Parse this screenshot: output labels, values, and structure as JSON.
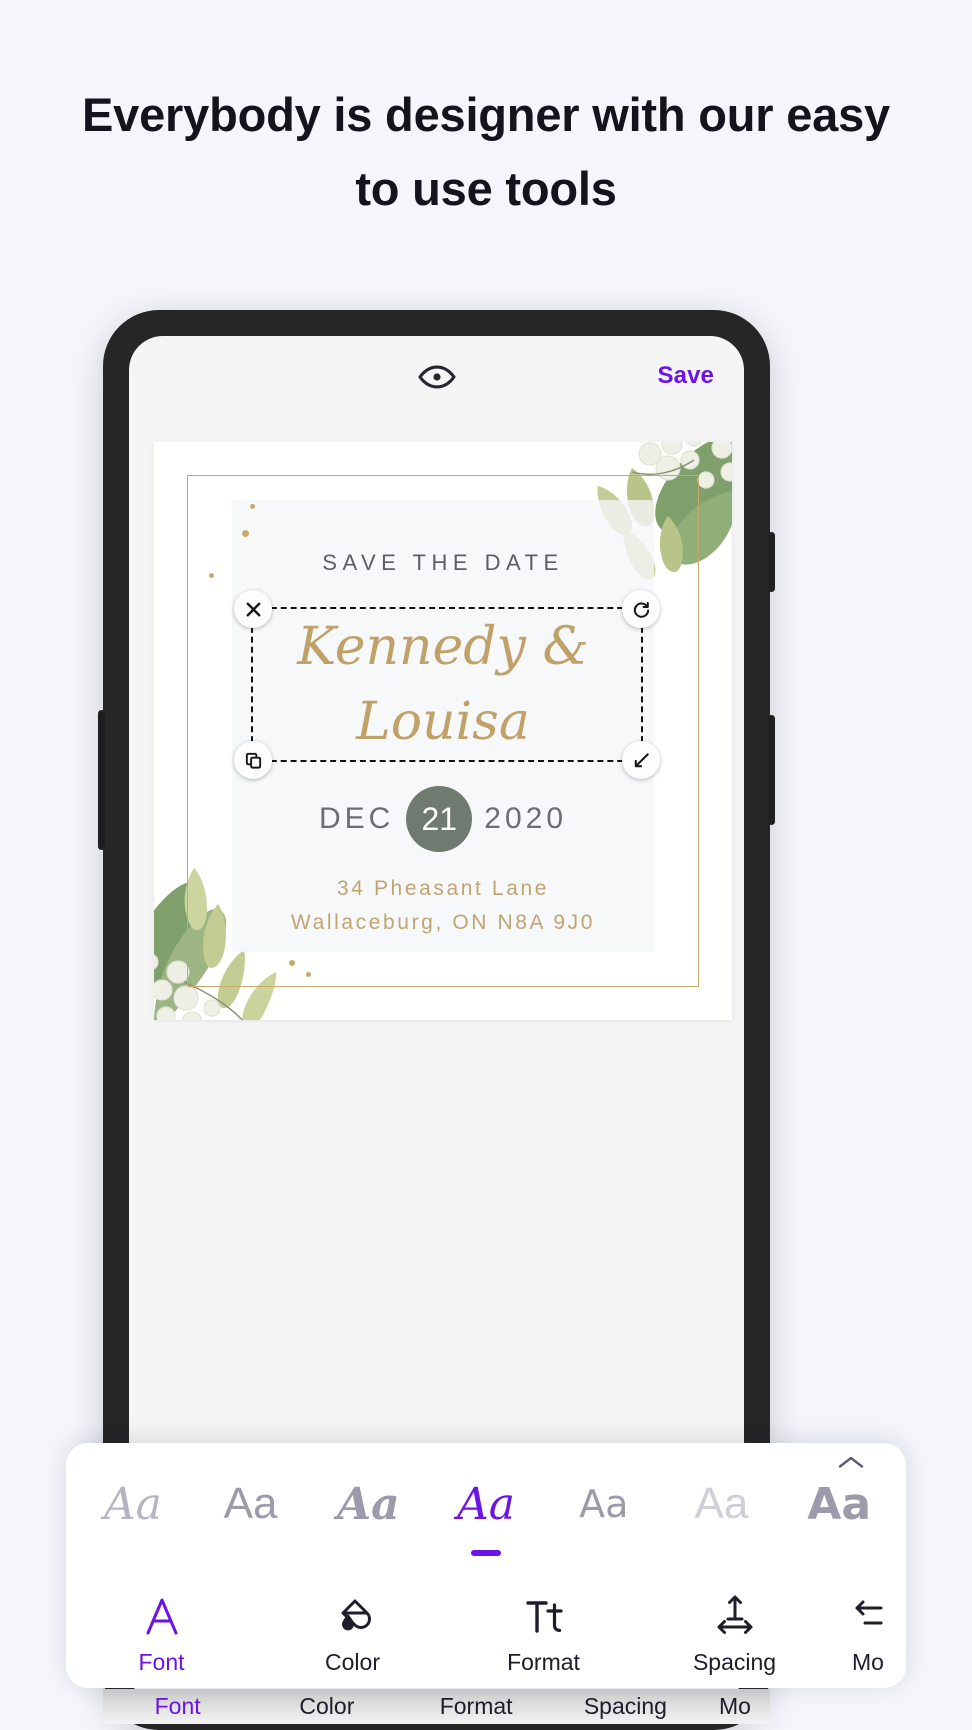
{
  "headline": "Everybody is designer with our easy to use tools",
  "appbar": {
    "preview_icon": "eye-icon",
    "save_label": "Save",
    "accent_color": "#6c13e8"
  },
  "card": {
    "eyebrow": "SAVE THE DATE",
    "name_line_1": "Kennedy &",
    "name_line_2": "Louisa",
    "date_month": "DEC",
    "date_day": "21",
    "date_year": "2020",
    "address_line_1": "34 Pheasant Lane",
    "address_line_2": "Wallaceburg, ON N8A 9J0",
    "gold_color": "#c0a269",
    "day_circle_color": "#6f7a71",
    "eyebrow_color": "#5a5f63"
  },
  "selection": {
    "delete_icon": "close-icon",
    "rotate_icon": "rotate-icon",
    "duplicate_icon": "duplicate-icon",
    "resize_icon": "resize-icon"
  },
  "font_picker": {
    "collapse_icon": "chevron-up-icon",
    "sample_label": "Aa",
    "options": [
      {
        "label": "Aa",
        "selected": false
      },
      {
        "label": "Aa",
        "selected": false
      },
      {
        "label": "Aa",
        "selected": false
      },
      {
        "label": "Aa",
        "selected": true
      },
      {
        "label": "Aa",
        "selected": false
      },
      {
        "label": "Aa",
        "selected": false
      },
      {
        "label": "Aa",
        "selected": false
      }
    ]
  },
  "toolbar": {
    "items": [
      {
        "label": "Font",
        "icon": "font-letter-a-icon",
        "active": true
      },
      {
        "label": "Color",
        "icon": "paint-drop-icon",
        "active": false
      },
      {
        "label": "Format",
        "icon": "text-format-tt-icon",
        "active": false
      },
      {
        "label": "Spacing",
        "icon": "spacing-arrows-icon",
        "active": false
      },
      {
        "label": "Mo",
        "icon": "more-arrows-icon",
        "active": false
      }
    ]
  },
  "strip": {
    "items": [
      {
        "label": "Font",
        "active": true
      },
      {
        "label": "Color",
        "active": false
      },
      {
        "label": "Format",
        "active": false
      },
      {
        "label": "Spacing",
        "active": false
      },
      {
        "label": "Mo",
        "active": false
      }
    ]
  }
}
